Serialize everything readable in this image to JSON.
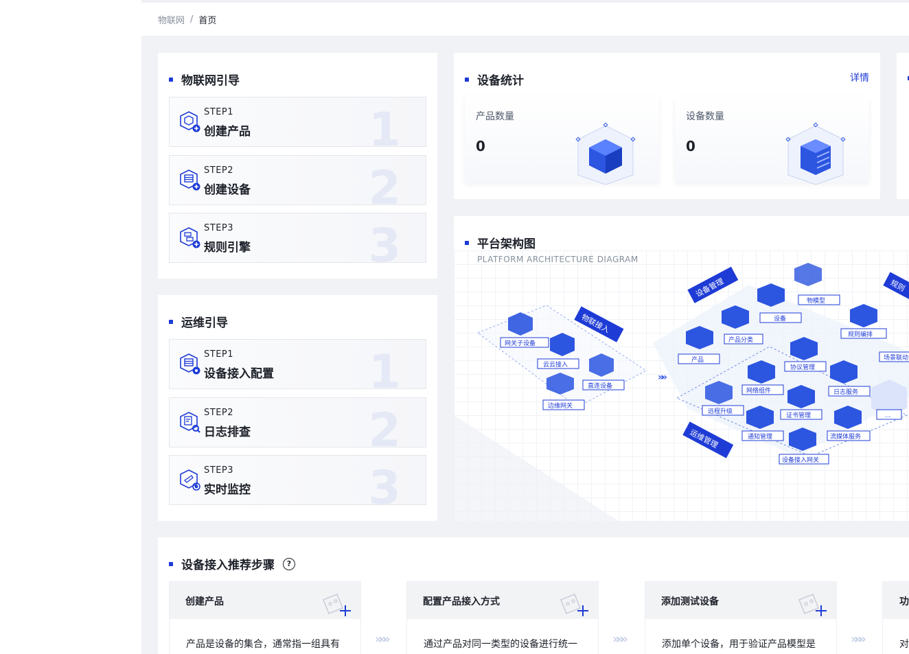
{
  "breadcrumb": {
    "root": "物联网",
    "separator": "/",
    "current": "首页"
  },
  "iot_guide": {
    "title": "物联网引导",
    "steps": [
      {
        "step": "STEP1",
        "name": "创建产品",
        "num": "1"
      },
      {
        "step": "STEP2",
        "name": "创建设备",
        "num": "2"
      },
      {
        "step": "STEP3",
        "name": "规则引擎",
        "num": "3"
      }
    ]
  },
  "ops_guide": {
    "title": "运维引导",
    "steps": [
      {
        "step": "STEP1",
        "name": "设备接入配置",
        "num": "1"
      },
      {
        "step": "STEP2",
        "name": "日志排查",
        "num": "2"
      },
      {
        "step": "STEP3",
        "name": "实时监控",
        "num": "3"
      }
    ]
  },
  "device_stats": {
    "title": "设备统计",
    "detail": "详情",
    "product_label": "产品数量",
    "product_value": "0",
    "device_label": "设备数量",
    "device_value": "0"
  },
  "architecture": {
    "title": "平台架构图",
    "subtitle": "PLATFORM ARCHITECTURE DIAGRAM",
    "labels": {
      "iot_access": "物联接入",
      "device_mgmt": "设备管理",
      "ops_mgmt": "运维管理",
      "rules": "规则",
      "gateway_sub": "网关子设备",
      "cloud_access": "云云接入",
      "direct_device": "直连设备",
      "edge_gateway": "边缘网关",
      "product": "产品",
      "product_category": "产品分类",
      "device": "设备",
      "thing_model": "物模型",
      "rule_orchestration": "规则编排",
      "scene_linkage": "场景联动",
      "protocol_mgmt": "协议管理",
      "network_component": "网络组件",
      "log_service": "日志服务",
      "remote_upgrade": "远程升级",
      "cert_mgmt": "证书管理",
      "notify_mgmt": "通知管理",
      "streaming_service": "流媒体服务",
      "device_access_gateway": "设备接入网关",
      "more": "..."
    }
  },
  "recommend": {
    "title": "设备接入推荐步骤",
    "help": "?",
    "items": [
      {
        "title": "创建产品",
        "desc": "产品是设备的集合，通常指一组具有"
      },
      {
        "title": "配置产品接入方式",
        "desc": "通过产品对同一类型的设备进行统一"
      },
      {
        "title": "添加测试设备",
        "desc": "添加单个设备，用于验证产品模型是"
      },
      {
        "title": "功",
        "desc": "对"
      }
    ],
    "chevrons": "»»»"
  },
  "colors": {
    "accent": "#1e3bd6",
    "background": "#f0f2f5"
  }
}
